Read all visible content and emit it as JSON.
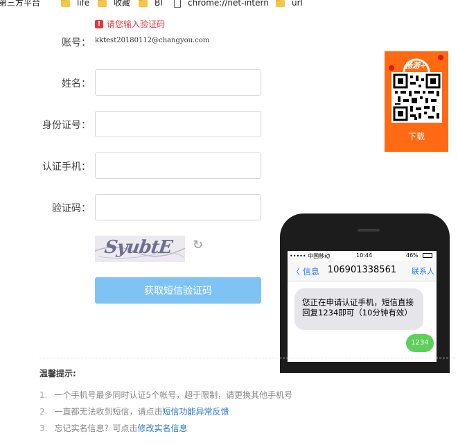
{
  "bookmarks": [
    {
      "label": "第三方平台",
      "icon": "folder-icon"
    },
    {
      "label": "life",
      "icon": "folder-icon"
    },
    {
      "label": "收藏",
      "icon": "folder-icon"
    },
    {
      "label": "BI",
      "icon": "folder-icon"
    },
    {
      "label": "chrome://net-intern",
      "icon": "page-icon"
    },
    {
      "label": "url",
      "icon": "folder-icon"
    }
  ],
  "form": {
    "error_icon": "!",
    "error_text": "请您输入验证码",
    "account_label": "账号：",
    "account_value": "kktest20180112@changyou.com",
    "name_label": "姓名：",
    "id_label": "身份证号：",
    "phone_label": "认证手机：",
    "code_label": "验证码：",
    "name_value": "",
    "id_value": "",
    "phone_value": "",
    "code_value": "",
    "captcha_text": "SyubtE",
    "refresh_glyph": "↻",
    "sms_button": "获取短信验证码"
  },
  "qr": {
    "logo_text": "畅游+",
    "download": "下载"
  },
  "phone": {
    "carrier": "••••• 中国移动",
    "time": "10:44",
    "battery": "46%",
    "back": "〈 信息",
    "number": "106901338561",
    "contact": "联系人",
    "incoming": "您正在申请认证手机，短信直接回复1234即可（10分钟有效）",
    "outgoing": "1234"
  },
  "tips": {
    "title": "温馨提示:",
    "items": [
      {
        "num": "1.",
        "text": "一个手机号最多同时认证5个帐号，超于限制，请更换其他手机号",
        "link": ""
      },
      {
        "num": "2.",
        "text": "一直都无法收到短信，请点击",
        "link": "短信功能异常反馈"
      },
      {
        "num": "3.",
        "text": "忘记实名信息？可点击",
        "link": "修改实名信息"
      }
    ]
  },
  "colors": {
    "error": "#e0393e",
    "button": "#7fc3f5",
    "qr_card": "#ff6a12",
    "link": "#2b7bd2",
    "sms_out": "#5dd05a"
  }
}
